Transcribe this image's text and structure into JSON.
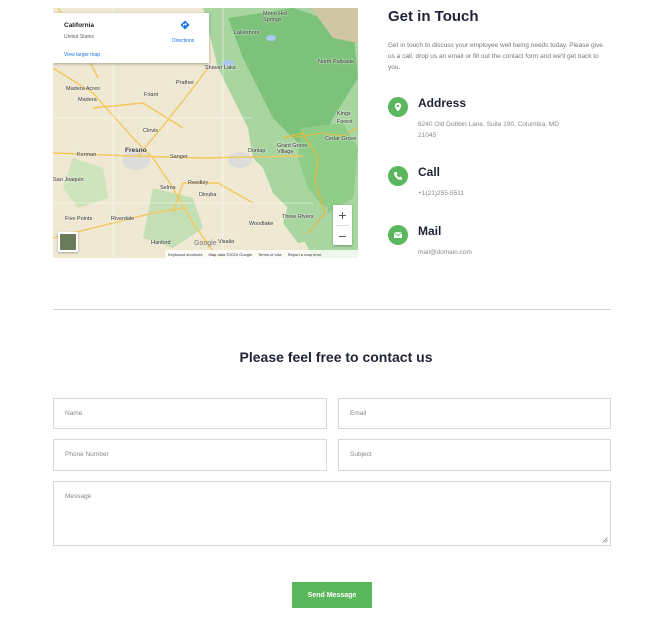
{
  "map": {
    "card": {
      "place": "California",
      "country": "United States",
      "larger_map": "View larger map",
      "directions": "Directions"
    },
    "labels": [
      {
        "text": "Fresno",
        "city": true
      },
      {
        "text": "Clovis"
      },
      {
        "text": "Madera"
      },
      {
        "text": "Madera Acres"
      },
      {
        "text": "Kerman"
      },
      {
        "text": "Sanger"
      },
      {
        "text": "Selma"
      },
      {
        "text": "Reedley"
      },
      {
        "text": "Dinuba"
      },
      {
        "text": "Prather"
      },
      {
        "text": "Friant"
      },
      {
        "text": "Shaver Lake"
      },
      {
        "text": "Lakeshore"
      },
      {
        "text": "Mono Hot Springs"
      },
      {
        "text": "Dunlap"
      },
      {
        "text": "Grant Grove Village"
      },
      {
        "text": "Three Rivers"
      },
      {
        "text": "Woodlake"
      },
      {
        "text": "Visalia"
      },
      {
        "text": "Hanford"
      },
      {
        "text": "Riverdale"
      },
      {
        "text": "Five Points"
      },
      {
        "text": "San Joaquin"
      },
      {
        "text": "North Palisade"
      },
      {
        "text": "Cedar Grove"
      },
      {
        "text": "Kings"
      },
      {
        "text": "Forest"
      }
    ],
    "google": "Google",
    "attribution": [
      "Keyboard shortcuts",
      "Map data ©2023 Google",
      "Terms of Use",
      "Report a map error"
    ],
    "zoom_in": "+",
    "zoom_out": "−"
  },
  "info": {
    "title": "Get in Touch",
    "description": "Get in touch to discuss your employee well being needs today. Please give us a call, drop us an email or fill out the contact form and we'll get back to you.",
    "address": {
      "label": "Address",
      "value": "6240 Old Dobbin Lane, Suite 190, Columbia, MD 21045",
      "icon": "location-pin-icon"
    },
    "call": {
      "label": "Call",
      "value": "+1(21)255-5511",
      "icon": "phone-icon"
    },
    "mail": {
      "label": "Mail",
      "value": "mail@domain.com",
      "icon": "envelope-icon"
    },
    "accent": "#5bb75b"
  },
  "form": {
    "title": "Please feel free to contact us",
    "name_placeholder": "Name",
    "email_placeholder": "Email",
    "phone_placeholder": "Phone Number",
    "subject_placeholder": "Subject",
    "message_placeholder": "Message",
    "submit": "Send Message"
  }
}
